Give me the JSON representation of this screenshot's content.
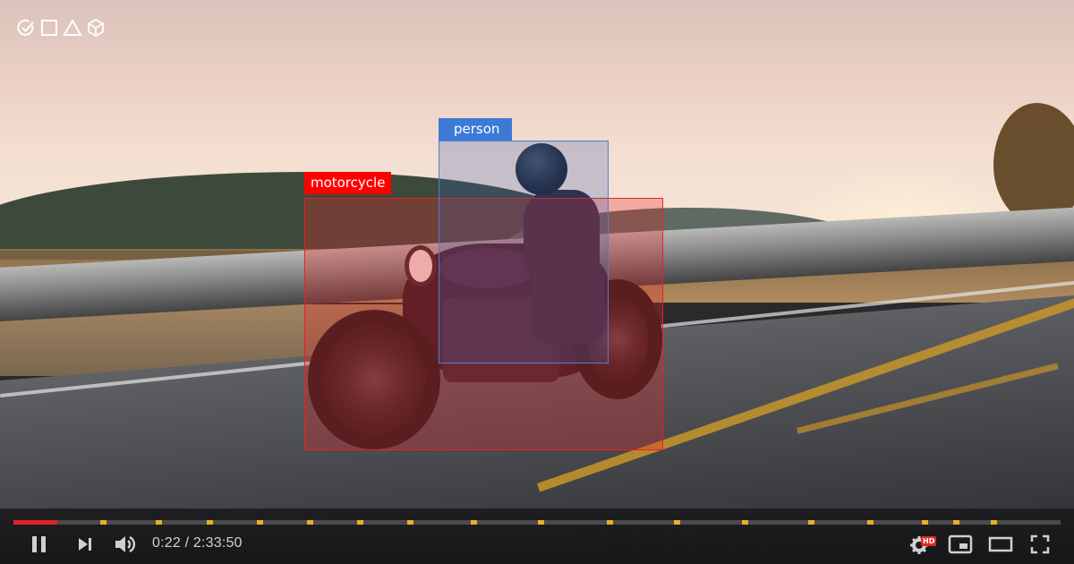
{
  "toolbar": {
    "icons": [
      "check-circle-icon",
      "square-icon",
      "triangle-icon",
      "cube-icon"
    ]
  },
  "detections": [
    {
      "label": "person",
      "color": "#3c7ad6"
    },
    {
      "label": "motorcycle",
      "color": "#ff0000"
    }
  ],
  "player": {
    "current_time": "0:22",
    "duration": "2:33:50",
    "time_display": "0:22 / 2:33:50",
    "progress_fraction": 0.0024,
    "played_color": "#e3202a",
    "marker_color": "#e8b21e",
    "chapter_markers_fraction": [
      0.042,
      0.097,
      0.148,
      0.198,
      0.248,
      0.298,
      0.348,
      0.412,
      0.479,
      0.547,
      0.614,
      0.682,
      0.748,
      0.807,
      0.862,
      0.893,
      0.93
    ],
    "hd_badge": "HD",
    "controls": {
      "pause": "pause-icon",
      "next": "next-icon",
      "volume": "volume-icon",
      "settings": "settings-icon",
      "miniplayer": "miniplayer-icon",
      "theater": "theater-mode-icon",
      "fullscreen": "fullscreen-icon"
    }
  }
}
